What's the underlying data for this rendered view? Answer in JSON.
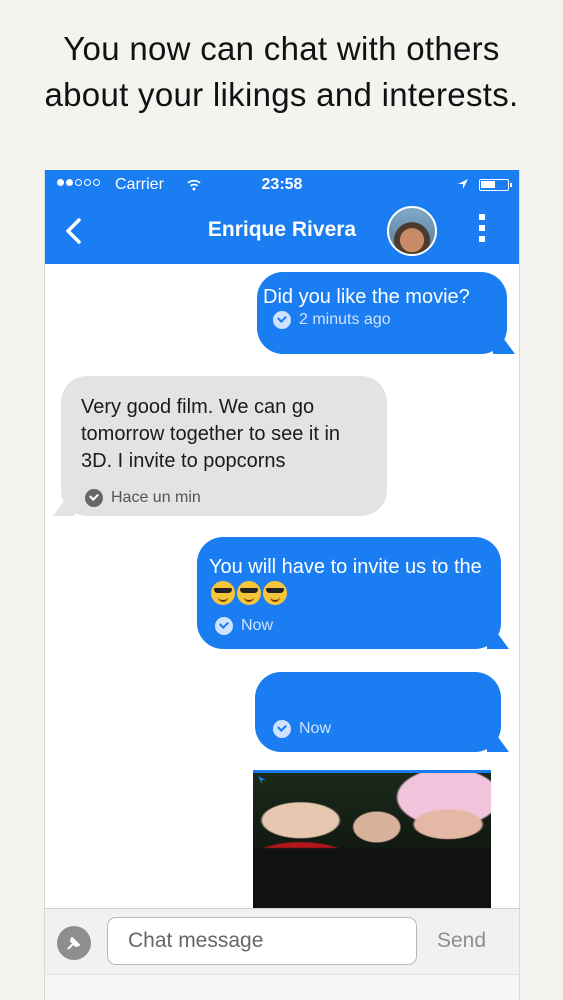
{
  "promo": {
    "line1": "You now can chat with others",
    "line2": "about your likings and interests."
  },
  "status_bar": {
    "carrier": "Carrier",
    "time": "23:58",
    "signal_bars_filled": 2,
    "signal_bars_total": 5
  },
  "chat_header": {
    "contact_name": "Enrique Rivera"
  },
  "messages": [
    {
      "direction": "outgoing",
      "text": "Did you like the movie?",
      "time": "2 minuts ago"
    },
    {
      "direction": "incoming",
      "text": "Very good film. We can go tomorrow together to see it in 3D. I invite to popcorns",
      "time": "Hace un min"
    },
    {
      "direction": "outgoing",
      "text": "You will have to invite us to the",
      "emoji": "sunglasses-emoji x3",
      "time": "Now"
    },
    {
      "direction": "outgoing",
      "text": "",
      "time": "Now"
    },
    {
      "direction": "outgoing",
      "type": "image"
    }
  ],
  "composer": {
    "placeholder": "Chat message",
    "send_label": "Send"
  },
  "colors": {
    "accent": "#1a7df2",
    "incoming_bubble": "#e3e3e3",
    "background": "#f4f3ef"
  }
}
